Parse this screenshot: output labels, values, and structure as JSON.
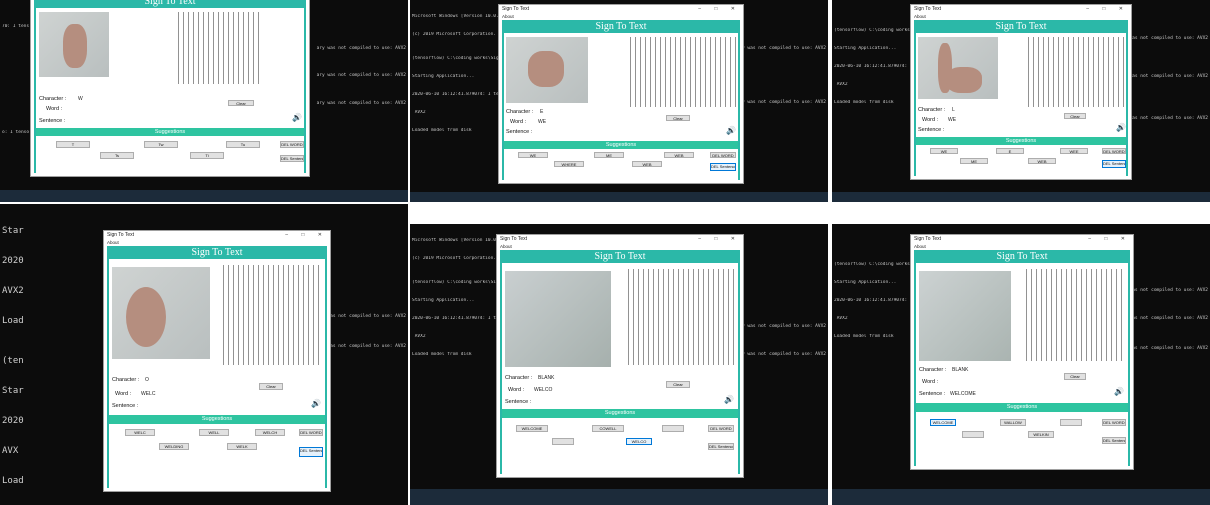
{
  "console": {
    "lines": [
      "Microsoft Windows [Version 10.0.18363]",
      "(c) 2019 Microsoft Corporation. All rights reserved.",
      "",
      "(tensorflow) C:\\coding works\\Sign-Language-to-Text>",
      "Starting Application...",
      "2020-06-10 16:12:41.879074: I tensorflow/core/platform/cpu_feature_guard.cc:142]",
      " AVX2",
      "Loaded model from disk",
      ""
    ],
    "right_fragment": "ary was not compiled to use: AVX2",
    "top_left_fragment_1": "70: I tens",
    "top_left_fragment_2": "o: I tenso",
    "side_fragments": [
      "Start",
      "2020",
      "AVX2",
      "Load",
      "(ten",
      "Star",
      "2020",
      "AVX",
      "Load"
    ]
  },
  "app": {
    "window_title": "Sign To Text",
    "menu_item": "About",
    "header_title": "Sign To Text",
    "character_label": "Character :",
    "word_label": "Word :",
    "sentence_label": "Sentence :",
    "suggestions_title": "Suggestions",
    "clear_button": "Clear",
    "del_sentence_button": "DEL Sentence",
    "del_word_button": "DEL WORD"
  },
  "panels": [
    {
      "character": "W",
      "word": "",
      "sentence": "",
      "suggestions": [
        "T",
        "Tw",
        "Tu",
        "Ts",
        "Ti",
        "DEL WORD"
      ]
    },
    {
      "character": "E",
      "word": "WE",
      "sentence": "",
      "suggestions": [
        "WE",
        "WE",
        "ME",
        "WEB",
        "WHERE",
        "WEB",
        "DEL WORD"
      ]
    },
    {
      "character": "L",
      "word": "WE",
      "sentence": "",
      "suggestions": [
        "WE",
        "E",
        "WEE",
        "ME",
        "WEB",
        "DEL WORD"
      ]
    },
    {
      "character": "O",
      "word": "WELC",
      "sentence": "",
      "suggestions": [
        "WELC",
        "WELL",
        "WELCH",
        "WELSH",
        "WELDING",
        "WELK",
        "DEL WORD"
      ]
    },
    {
      "character": "BLANK",
      "word": "WELCO",
      "sentence": "",
      "suggestions": [
        "WELCOME",
        "COWELL",
        "",
        "DEL WORD",
        "",
        "WELCO"
      ]
    },
    {
      "character": "BLANK",
      "word": "",
      "sentence": "WELCOME",
      "suggestions": [
        "WELCOME",
        "WALLOW",
        "",
        "DEL WORD",
        "",
        "WELKIN"
      ]
    }
  ]
}
